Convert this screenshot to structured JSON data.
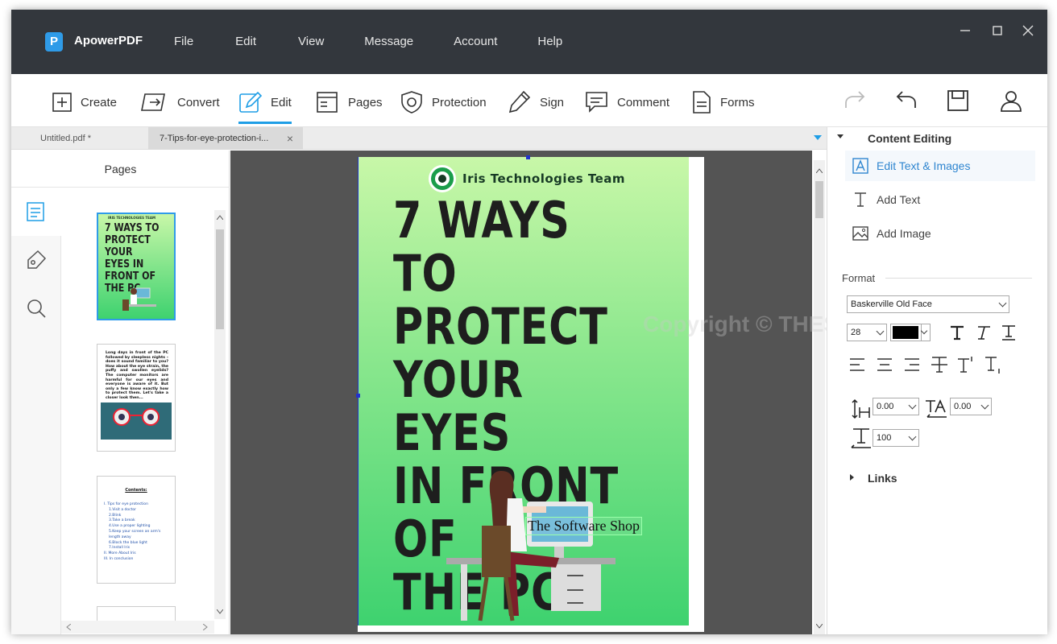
{
  "app": {
    "name": "ApowerPDF",
    "logo_letter": "P"
  },
  "menu": [
    "File",
    "Edit",
    "View",
    "Message",
    "Account",
    "Help"
  ],
  "toolbar": {
    "create": "Create",
    "convert": "Convert",
    "edit": "Edit",
    "pages": "Pages",
    "protection": "Protection",
    "sign": "Sign",
    "comment": "Comment",
    "forms": "Forms"
  },
  "tabs": [
    {
      "label": "Untitled.pdf *"
    },
    {
      "label": "7-Tips-for-eye-protection-i...",
      "close": "×"
    }
  ],
  "left_panel": {
    "title": "Pages"
  },
  "thumbs": {
    "t1_brand": "IRIS TECHNOLOGIES TEAM",
    "t1_title": "7 WAYS TO PROTECT YOUR EYES IN FRONT OF THE PC",
    "t2_text": "Long days in front of the PC followed by sleepless nights – does it sound familiar to you? How about the eye strain, the puffy and swollen eyelids? The computer monitors are harmful for our eyes and everyone is aware of it. But only a few know exactly how to protect them. Let's take a closer look then...",
    "t3_title": "Contents:",
    "t3_items": [
      "I.   Tips for eye protection",
      "1.Visit a doctor",
      "2.Blink",
      "3.Take a break",
      "4.Use a proper lighting",
      "5.Keep your screen an arm's length away",
      "6.Block the blue light",
      "7.Install Iris",
      "II.  More About Iris",
      "III. In conclusion"
    ]
  },
  "document": {
    "brand": "Iris Technologies Team",
    "title": "7 WAYS TO\nPROTECT\nYOUR EYES\nIN FRONT OF\nTHE PC",
    "text_box": "The Software Shop",
    "watermark": "Copyright © THESOFTWARE.SHOP"
  },
  "right_panel": {
    "content_editing": "Content Editing",
    "edit_text_images": "Edit Text & Images",
    "add_text": "Add Text",
    "add_image": "Add Image",
    "format": "Format",
    "font": "Baskerville Old Face",
    "font_size": "28",
    "line_spacing": "0.00",
    "char_spacing": "0.00",
    "scale": "100",
    "links": "Links"
  },
  "colors": {
    "accent": "#1e9ee6",
    "titlebar": "#33373d",
    "text_color_swatch": "#000000"
  }
}
